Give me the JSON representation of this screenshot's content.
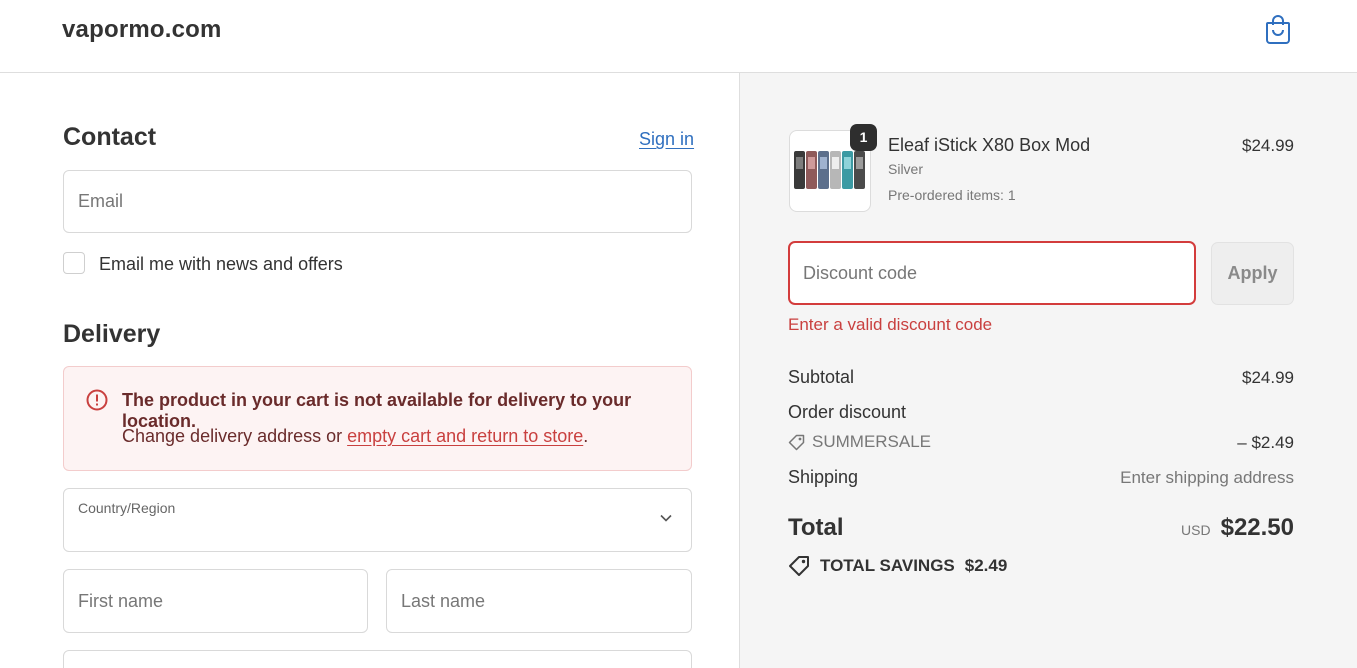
{
  "header": {
    "brand": "vapormo.com",
    "cart_icon": "shopping-bag-icon"
  },
  "contact": {
    "title": "Contact",
    "sign_in": "Sign in",
    "email_placeholder": "Email",
    "newsletter_label": "Email me with news and offers"
  },
  "delivery": {
    "title": "Delivery",
    "alert": {
      "icon": "alert-circle-icon",
      "title": "The product in your cart is not available for delivery to your location.",
      "body_prefix": "Change delivery address or ",
      "link": "empty cart and return to store",
      "body_suffix": "."
    },
    "country_label": "Country/Region",
    "first_name_placeholder": "First name",
    "last_name_placeholder": "Last name"
  },
  "summary": {
    "item": {
      "quantity": "1",
      "name": "Eleaf iStick X80 Box Mod",
      "variant": "Silver",
      "preorder": "Pre-ordered items: 1",
      "price": "$24.99"
    },
    "discount": {
      "placeholder": "Discount code",
      "apply": "Apply",
      "error": "Enter a valid discount code"
    },
    "subtotal_label": "Subtotal",
    "subtotal_value": "$24.99",
    "order_discount_label": "Order discount",
    "discount_code": "SUMMERSALE",
    "discount_value": "– $2.49",
    "shipping_label": "Shipping",
    "shipping_value": "Enter shipping address",
    "total_label": "Total",
    "currency": "USD",
    "total_value": "$22.50",
    "savings_label": "TOTAL SAVINGS",
    "savings_value": "$2.49"
  },
  "colors": {
    "error": "#c9403f",
    "link": "#2f6fbf",
    "summary_bg": "#f5f5f5",
    "alert_bg": "#fdf3f3"
  }
}
